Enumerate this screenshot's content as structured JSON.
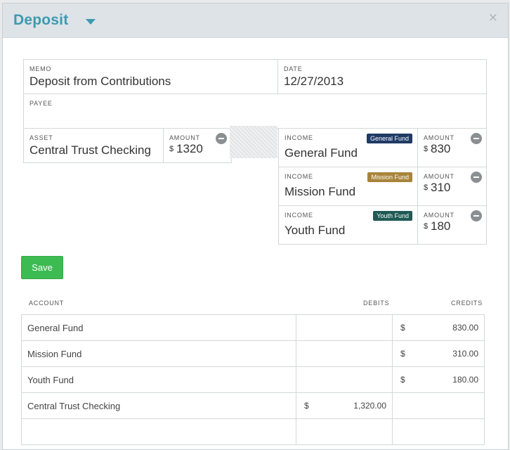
{
  "modal": {
    "title": "Deposit",
    "close_glyph": "×"
  },
  "form": {
    "memo": {
      "label": "MEMO",
      "value": "Deposit from Contributions"
    },
    "date": {
      "label": "DATE",
      "value": "12/27/2013"
    },
    "payee": {
      "label": "PAYEE",
      "value": ""
    },
    "asset": {
      "label": "ASSET",
      "value": "Central Trust Checking",
      "amount_label": "AMOUNT",
      "currency": "$",
      "amount": "1320"
    },
    "income": [
      {
        "label": "INCOME",
        "value": "General Fund",
        "badge": "General Fund",
        "badge_color": "#1f3b66",
        "amount_label": "AMOUNT",
        "currency": "$",
        "amount": "830"
      },
      {
        "label": "INCOME",
        "value": "Mission Fund",
        "badge": "Mission Fund",
        "badge_color": "#a8843a",
        "amount_label": "AMOUNT",
        "currency": "$",
        "amount": "310"
      },
      {
        "label": "INCOME",
        "value": "Youth Fund",
        "badge": "Youth Fund",
        "badge_color": "#1f5a55",
        "amount_label": "AMOUNT",
        "currency": "$",
        "amount": "180"
      }
    ],
    "save_label": "Save"
  },
  "ledger": {
    "headers": {
      "account": "ACCOUNT",
      "debits": "DEBITS",
      "credits": "CREDITS"
    },
    "rows": [
      {
        "account": "General Fund",
        "debit_symbol": "",
        "debit": "",
        "credit_symbol": "$",
        "credit": "830.00"
      },
      {
        "account": "Mission Fund",
        "debit_symbol": "",
        "debit": "",
        "credit_symbol": "$",
        "credit": "310.00"
      },
      {
        "account": "Youth Fund",
        "debit_symbol": "",
        "debit": "",
        "credit_symbol": "$",
        "credit": "180.00"
      },
      {
        "account": "Central Trust Checking",
        "debit_symbol": "$",
        "debit": "1,320.00",
        "credit_symbol": "",
        "credit": ""
      },
      {
        "account": "",
        "debit_symbol": "",
        "debit": "",
        "credit_symbol": "",
        "credit": ""
      }
    ]
  },
  "colors": {
    "accent": "#3d9ab0",
    "save": "#3cbb52"
  },
  "icons": {
    "title_dropdown": "caret-down-icon",
    "close": "close-icon",
    "remove": "minus-circle-icon"
  }
}
